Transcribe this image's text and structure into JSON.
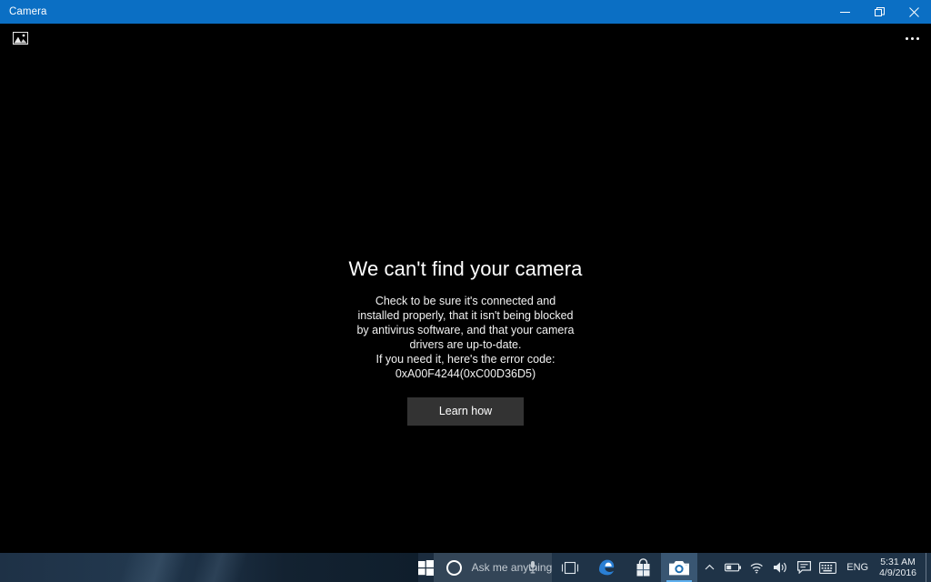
{
  "window": {
    "title": "Camera",
    "controls": {
      "minimize": "Minimize",
      "restore": "Restore",
      "close": "Close"
    },
    "commandbar": {
      "gallery_label": "Gallery",
      "more_label": "See more"
    }
  },
  "error": {
    "title": "We can't find your camera",
    "body_lines": [
      "Check to be sure it's connected and",
      "installed properly, that it isn't being blocked",
      "by antivirus software, and that your camera",
      "drivers are up-to-date.",
      "If you need it, here's the error code:"
    ],
    "code": "0xA00F4244(0xC00D36D5)",
    "button_label": "Learn how"
  },
  "taskbar": {
    "start_label": "Start",
    "search": {
      "placeholder": "Ask me anything",
      "cortana_label": "Cortana",
      "mic_label": "Talk to Cortana"
    },
    "apps": [
      {
        "name": "task-view",
        "label": "Task View",
        "active": false
      },
      {
        "name": "microsoft-edge",
        "label": "Microsoft Edge",
        "active": false
      },
      {
        "name": "microsoft-store",
        "label": "Store",
        "active": false
      },
      {
        "name": "camera",
        "label": "Camera",
        "active": true
      }
    ],
    "tray": {
      "show_hidden_label": "Show hidden icons",
      "battery_label": "Battery",
      "network_label": "Network",
      "volume_label": "Speakers",
      "action_center_label": "Action Center",
      "keyboard_label": "Touch keyboard",
      "language": "ENG",
      "time": "5:31 AM",
      "date": "4/9/2016",
      "show_desktop_label": "Show desktop"
    }
  },
  "colors": {
    "titlebar": "#0b6fc4",
    "app_background": "#000000",
    "button": "#333333",
    "taskbar": "#1f3347",
    "accent": "#5fb0ef"
  }
}
